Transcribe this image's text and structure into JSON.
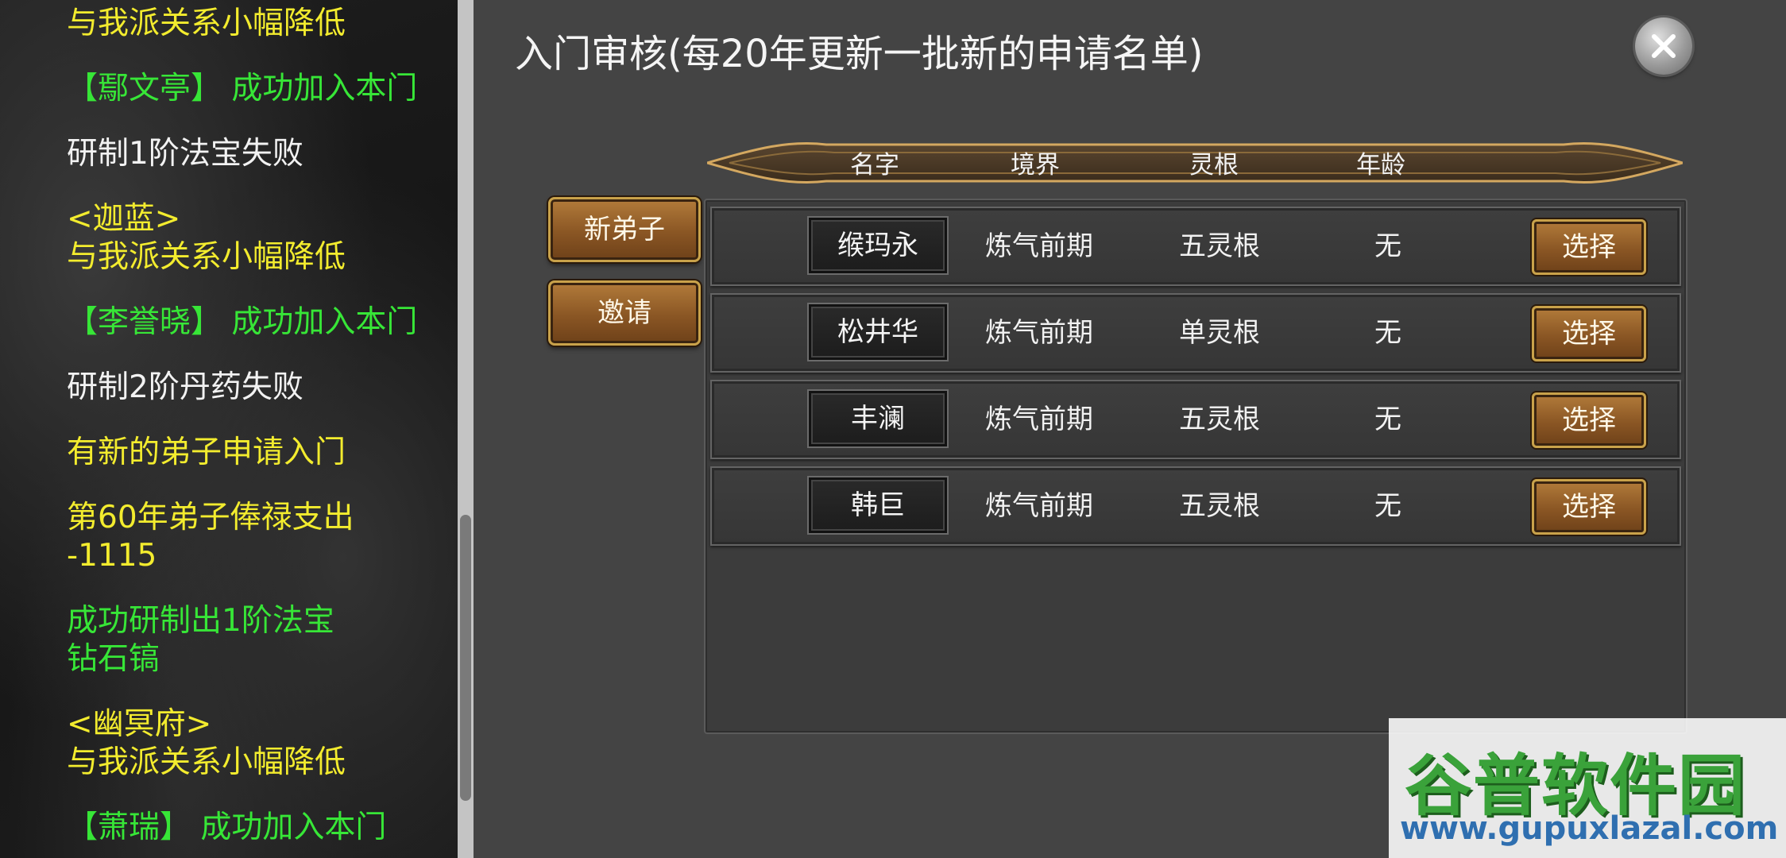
{
  "log": {
    "entries": [
      {
        "lines": [
          "与我派关系小幅降低"
        ],
        "color": "yellow"
      },
      {
        "lines": [
          "【鄢文亭】 成功加入本门"
        ],
        "color": "green"
      },
      {
        "lines": [
          "研制1阶法宝失败"
        ],
        "color": "white"
      },
      {
        "lines": [
          "<迦蓝>",
          "与我派关系小幅降低"
        ],
        "color": "yellow"
      },
      {
        "lines": [
          "【李誉晓】 成功加入本门"
        ],
        "color": "green"
      },
      {
        "lines": [
          "研制2阶丹药失败"
        ],
        "color": "white"
      },
      {
        "lines": [
          "有新的弟子申请入门"
        ],
        "color": "yellow"
      },
      {
        "lines": [
          "第60年弟子俸禄支出",
          "-1115"
        ],
        "color": "yellow"
      },
      {
        "lines": [
          "成功研制出1阶法宝",
          "钻石镐"
        ],
        "color": "green"
      },
      {
        "lines": [
          "<幽冥府>",
          "与我派关系小幅降低"
        ],
        "color": "yellow"
      },
      {
        "lines": [
          "【萧瑞】 成功加入本门"
        ],
        "color": "green"
      }
    ]
  },
  "dialog": {
    "title": "入门审核(每20年更新一批新的申请名单)",
    "close_icon": "close-x-icon",
    "tabs": {
      "new_disciple": "新弟子",
      "invite": "邀请"
    },
    "columns": {
      "name": "名字",
      "realm": "境界",
      "root": "灵根",
      "age": "年龄"
    },
    "applicants": [
      {
        "name": "缑玛永",
        "realm": "炼气前期",
        "root": "五灵根",
        "age": "无",
        "action": "选择"
      },
      {
        "name": "松井华",
        "realm": "炼气前期",
        "root": "单灵根",
        "age": "无",
        "action": "选择"
      },
      {
        "name": "丰澜",
        "realm": "炼气前期",
        "root": "五灵根",
        "age": "无",
        "action": "选择"
      },
      {
        "name": "韩巨",
        "realm": "炼气前期",
        "root": "五灵根",
        "age": "无",
        "action": "选择"
      }
    ]
  },
  "watermark": {
    "logo_text": "谷普软件园",
    "url": "www.gupuxlazal.com"
  },
  "colors": {
    "log_yellow": "#f3ec2e",
    "log_green": "#37e637",
    "log_white": "#f2f2f2",
    "button_gold": "#c9a24a",
    "button_brown": "#8a5624",
    "dialog_bg": "#444444"
  }
}
